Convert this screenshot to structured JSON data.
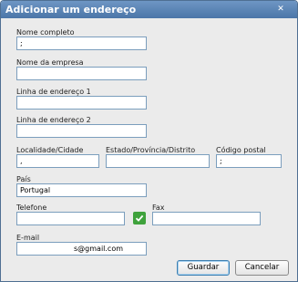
{
  "window": {
    "title": "Adicionar um endereço",
    "close_icon": "✕"
  },
  "form": {
    "full_name": {
      "label": "Nome completo",
      "value": ";"
    },
    "company": {
      "label": "Nome da empresa",
      "value": ""
    },
    "address_line1": {
      "label": "Linha de endereço 1",
      "value": ""
    },
    "address_line2": {
      "label": "Linha de endereço 2",
      "value": ""
    },
    "city": {
      "label": "Localidade/Cidade",
      "value": ","
    },
    "state": {
      "label": "Estado/Província/Distrito",
      "value": ""
    },
    "postal_code": {
      "label": "Código postal",
      "value": ";"
    },
    "country": {
      "label": "País",
      "value": "Portugal"
    },
    "phone": {
      "label": "Telefone",
      "value": ""
    },
    "fax": {
      "label": "Fax",
      "value": ""
    },
    "email": {
      "label": "E-mail",
      "value": "s@gmail.com"
    }
  },
  "icons": {
    "phone_valid": "check-icon",
    "check_color": "#3fa23c"
  },
  "buttons": {
    "save": "Guardar",
    "cancel": "Cancelar"
  },
  "colors": {
    "titlebar": "#5a84b6",
    "field_border": "#7b9ebd",
    "dialog_bg": "#ebebeb"
  }
}
